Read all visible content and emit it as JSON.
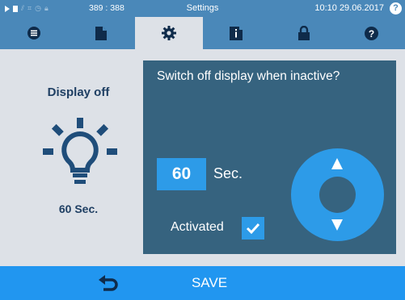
{
  "status_bar": {
    "coordinates": "389 : 388",
    "title": "Settings",
    "time": "10:10",
    "date": "29.06.2017",
    "help_label": "?",
    "icons": [
      "play-icon",
      "document-icon",
      "chart-icon",
      "clock-icon",
      "lock-icon"
    ]
  },
  "tabs": [
    {
      "icon": "menu-list-icon",
      "active": false
    },
    {
      "icon": "document-icon",
      "active": false
    },
    {
      "icon": "gear-icon",
      "active": true
    },
    {
      "icon": "info-book-icon",
      "active": false
    },
    {
      "icon": "lock-icon",
      "active": false
    },
    {
      "icon": "help-icon",
      "active": false
    }
  ],
  "left": {
    "title": "Display off",
    "icon": "lightbulb-icon",
    "value": "60 Sec."
  },
  "panel": {
    "title": "Switch off display when inactive?",
    "value": "60",
    "unit": "Sec.",
    "activated_label": "Activated",
    "activated": true
  },
  "bottom_bar": {
    "back_icon": "back-arrow-icon",
    "save_label": "SAVE"
  },
  "colors": {
    "header": "#4a88b9",
    "background": "#dde1e7",
    "panel": "#36637f",
    "accent": "#2196f0",
    "text_dark": "#1f3f63"
  }
}
